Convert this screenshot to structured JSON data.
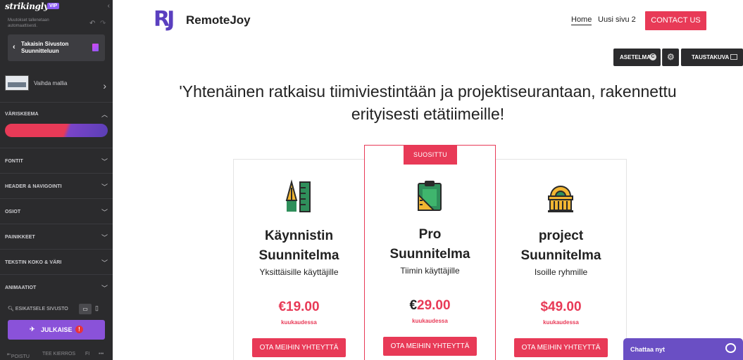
{
  "editor": {
    "brand": "strikingly",
    "vip": "VIP",
    "autosave": "Muutokset tallenetaan automaattisesti.",
    "back_label": "Takaisin Sivuston Suunnitteluun",
    "template_label": "Vaihda mallia",
    "sections": [
      {
        "label": "VÄRISKEEMA",
        "expanded": true
      },
      {
        "label": "FONTIT",
        "expanded": false
      },
      {
        "label": "HEADER & NAVIGOINTI",
        "expanded": false
      },
      {
        "label": "OSIOT",
        "expanded": false
      },
      {
        "label": "PAINIKKEET",
        "expanded": false
      },
      {
        "label": "TEKSTIN KOKO & VÄRI",
        "expanded": false
      },
      {
        "label": "ANIMAATIOT",
        "expanded": false
      }
    ],
    "color_scheme": {
      "primary": "#e83a57",
      "secondary": "#5b3fb6"
    },
    "preview_label": "ESIKATSELE SIVUSTO",
    "publish_label": "JULKAISE",
    "publish_warning": "!",
    "footer": {
      "exit": "POISTU",
      "help": "TEE KIERROS",
      "lang": "FI",
      "more": "•••"
    }
  },
  "site": {
    "logo_mark": "RJ",
    "logo_text": "RemoteJoy",
    "nav": {
      "home": "Home",
      "page2": "Uusi sivu 2",
      "contact": "CONTACT US"
    },
    "toolbar": {
      "layout": "ASETELMA",
      "layout_badge": "C",
      "background": "TAUSTAKUVA"
    },
    "headline": "'Yhtenäinen ratkaisu tiimiviestintään ja projektiseurantaan, rakennettu erityisesti etätiimeille!",
    "plans": [
      {
        "title_l1": "Käynnistin",
        "title_l2": "Suunnitelma",
        "subtitle": "Yksittäisille käyttäjille",
        "currency": "€",
        "price": "19.00",
        "period": "kuukaudessa",
        "cta": "OTA MEIHIN YHTEYTTÄ",
        "icon": "drafting-tools-icon"
      },
      {
        "badge": "SUOSITTU",
        "title_l1": "Pro",
        "title_l2": "Suunnitelma",
        "subtitle": "Tiimin käyttäjille",
        "currency": "€",
        "price": "29.00",
        "period": "kuukaudessa",
        "cta": "OTA MEIHIN YHTEYTTÄ",
        "icon": "clipboard-ruler-icon"
      },
      {
        "title_l1": "project",
        "title_l2": "Suunnitelma",
        "subtitle": "Isoille ryhmille",
        "price_full": "$49.00",
        "period": "kuukaudessa",
        "cta": "OTA MEIHIN YHTEYTTÄ",
        "icon": "building-dome-icon"
      }
    ],
    "chat": "Chattaa nyt"
  }
}
